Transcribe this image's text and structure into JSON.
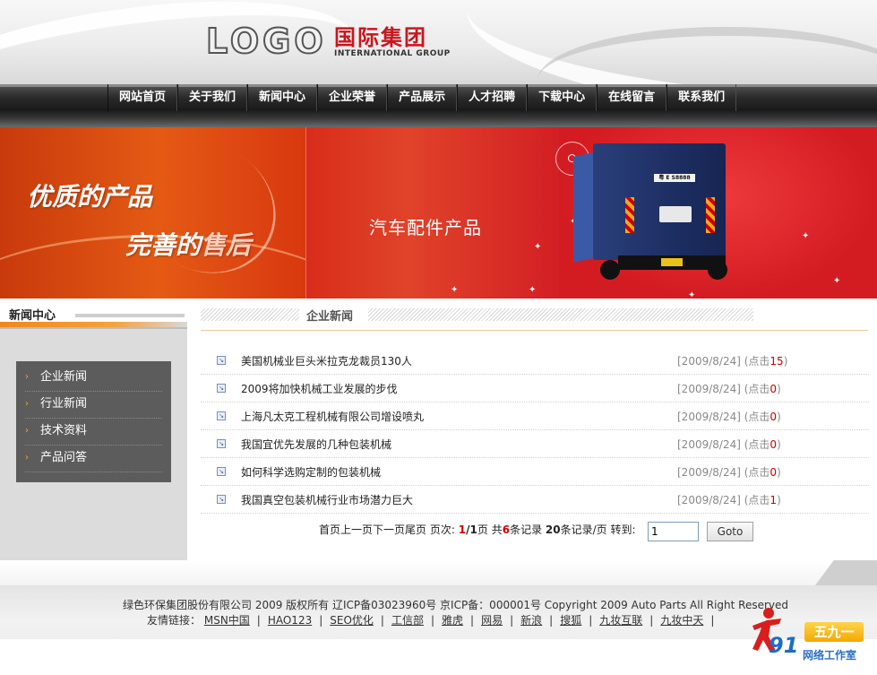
{
  "header": {
    "logo_text": "LOGO",
    "company_cn": "国际集团",
    "company_en": "INTERNATIONAL GROUP"
  },
  "nav": {
    "items": [
      "网站首页",
      "关于我们",
      "新闻中心",
      "企业荣誉",
      "产品展示",
      "人才招聘",
      "下载中心",
      "在线留言",
      "联系我们"
    ]
  },
  "banner": {
    "slogan_1": "优质的产品",
    "slogan_2a": "完善的",
    "slogan_2b": "售后",
    "center_text": "汽车配件产品",
    "truck_plate": "粤 E S8888"
  },
  "sidebar": {
    "title": "新闻中心",
    "items": [
      "企业新闻",
      "行业新闻",
      "技术资料",
      "产品问答"
    ]
  },
  "main": {
    "title": "企业新闻",
    "news": [
      {
        "title": "美国机械业巨头米拉克龙裁员130人",
        "date": "[2009/8/24]",
        "clicks_label": "(点击",
        "clicks": "15",
        "close": ")"
      },
      {
        "title": "2009将加快机械工业发展的步伐",
        "date": "[2009/8/24]",
        "clicks_label": "(点击",
        "clicks": "0",
        "close": ")"
      },
      {
        "title": "上海凡太克工程机械有限公司增设喷丸",
        "date": "[2009/8/24]",
        "clicks_label": "(点击",
        "clicks": "0",
        "close": ")"
      },
      {
        "title": "我国宜优先发展的几种包装机械",
        "date": "[2009/8/24]",
        "clicks_label": "(点击",
        "clicks": "0",
        "close": ")"
      },
      {
        "title": "如何科学选购定制的包装机械",
        "date": "[2009/8/24]",
        "clicks_label": "(点击",
        "clicks": "0",
        "close": ")"
      },
      {
        "title": "我国真空包装机械行业市场潜力巨大",
        "date": "[2009/8/24]",
        "clicks_label": "(点击",
        "clicks": "1",
        "close": ")"
      }
    ],
    "pager": {
      "first": "首页",
      "prev": "上一页",
      "next": "下一页",
      "last": "尾页",
      "pages_label": "页次:",
      "current": "1",
      "total": "/1",
      "page_unit": "页",
      "total_label": "共",
      "records": "6",
      "records_unit": "条记录",
      "per_page": "20",
      "per_page_unit": "条记录/页",
      "goto_label": "转到:",
      "input_value": "1",
      "goto_button": "Goto"
    }
  },
  "footer": {
    "copyright": "绿色环保集团股份有限公司 2009 版权所有 辽ICP备03023960号 京ICP备：000001号 Copyright 2009 Auto Parts All Right Reserved",
    "links_label": "友情链接：",
    "links": [
      "MSN中国",
      "HAO123",
      "SEO优化",
      "工信部",
      "雅虎",
      "网易",
      "新浪",
      "搜狐",
      "九妆互联",
      "九妆中天"
    ]
  },
  "watermark": {
    "number": "91",
    "badge": "五九一",
    "studio": "网络工作室"
  }
}
